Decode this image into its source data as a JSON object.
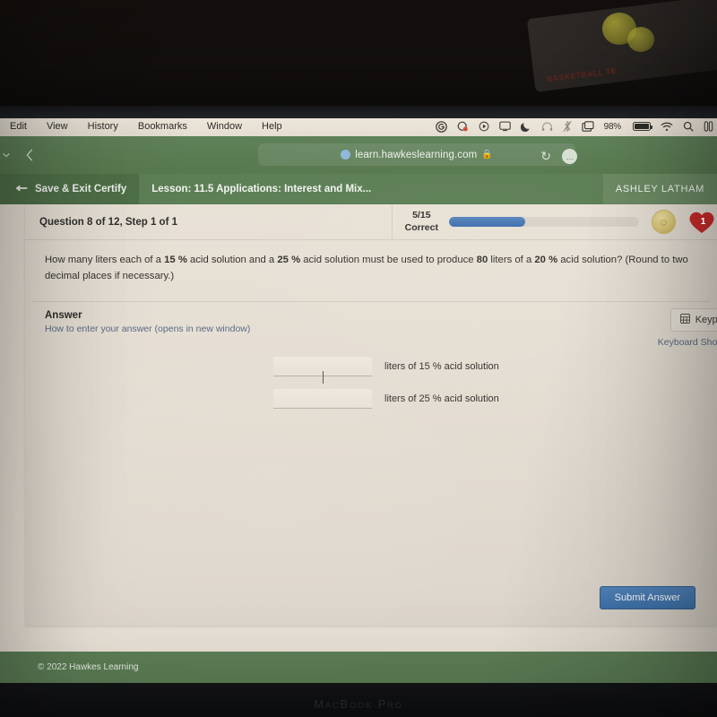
{
  "device": {
    "brand": "MacBook Pro"
  },
  "background": {
    "poster_text": "BASKETBALL TE"
  },
  "menubar": {
    "items": [
      "Edit",
      "View",
      "History",
      "Bookmarks",
      "Window",
      "Help"
    ],
    "status": {
      "battery_percent": "98%",
      "icons": [
        "grammarly-icon",
        "cleanup-icon",
        "record-icon",
        "display-icon",
        "do-not-disturb-icon",
        "headphones-icon",
        "bluetooth-icon",
        "screen-mirroring-icon",
        "battery-icon",
        "wifi-icon",
        "search-icon",
        "control-center-icon"
      ]
    }
  },
  "browser": {
    "back_label": "‹",
    "url": "learn.hawkeslearning.com",
    "lock_icon": "🔒",
    "reload_icon": "↻",
    "menu_icon": "…"
  },
  "app_header": {
    "save_exit_label": "Save & Exit Certify",
    "lesson_title": "Lesson: 11.5 Applications: Interest and Mix...",
    "user_name": "ASHLEY LATHAM"
  },
  "question": {
    "position_label": "Question 8 of 12, Step 1 of 1",
    "score_value": "5/15",
    "score_label": "Correct",
    "progress_percent": 40,
    "coin_icon": "coin-icon",
    "lives_count": "1",
    "text_part1": "How many liters each of a ",
    "pct1": "15 %",
    "text_part2": " acid solution and a ",
    "pct2": "25 %",
    "text_part3": " acid solution must be used to produce ",
    "volume": "80",
    "text_part4": " liters of a ",
    "pct3": "20 %",
    "text_part5": " acid solution? (Round to two decimal places if necessary.)"
  },
  "answer": {
    "title": "Answer",
    "help_link": "How to enter your answer (opens in new window)",
    "keypad_label": "Keypad",
    "keyboard_shortcuts": "Keyboard Shortcuts",
    "fields": [
      {
        "value": "",
        "placeholder": "",
        "label": "liters of 15 %  acid solution"
      },
      {
        "value": "",
        "placeholder": "",
        "label": "liters of 25 %  acid solution"
      }
    ],
    "submit_label": "Submit Answer"
  },
  "footer": {
    "copyright": "© 2022 Hawkes Learning"
  },
  "colors": {
    "app_green": "#5d7f56",
    "progress_blue": "#3f6ead",
    "submit_blue": "#4278b1",
    "link_blue": "#5b6b86",
    "heart_red": "#cc2a2a"
  }
}
